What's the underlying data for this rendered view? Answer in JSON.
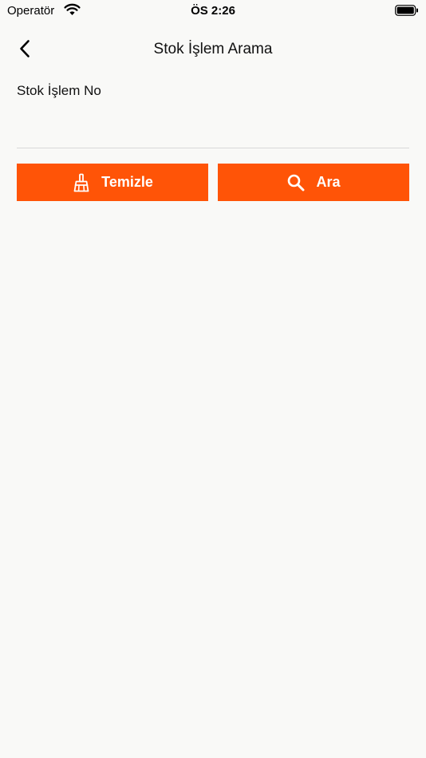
{
  "status_bar": {
    "carrier": "Operatör",
    "time": "ÖS 2:26",
    "wifi_icon": "wifi-icon",
    "battery_icon": "battery-icon"
  },
  "nav": {
    "title": "Stok İşlem Arama",
    "back_icon": "chevron-left-icon"
  },
  "form": {
    "field_label": "Stok İşlem No",
    "field_value": "",
    "field_placeholder": ""
  },
  "buttons": {
    "clear_label": "Temizle",
    "clear_icon": "broom-icon",
    "search_label": "Ara",
    "search_icon": "search-icon"
  },
  "colors": {
    "accent": "#ff5407",
    "background": "#f9f9f7"
  }
}
